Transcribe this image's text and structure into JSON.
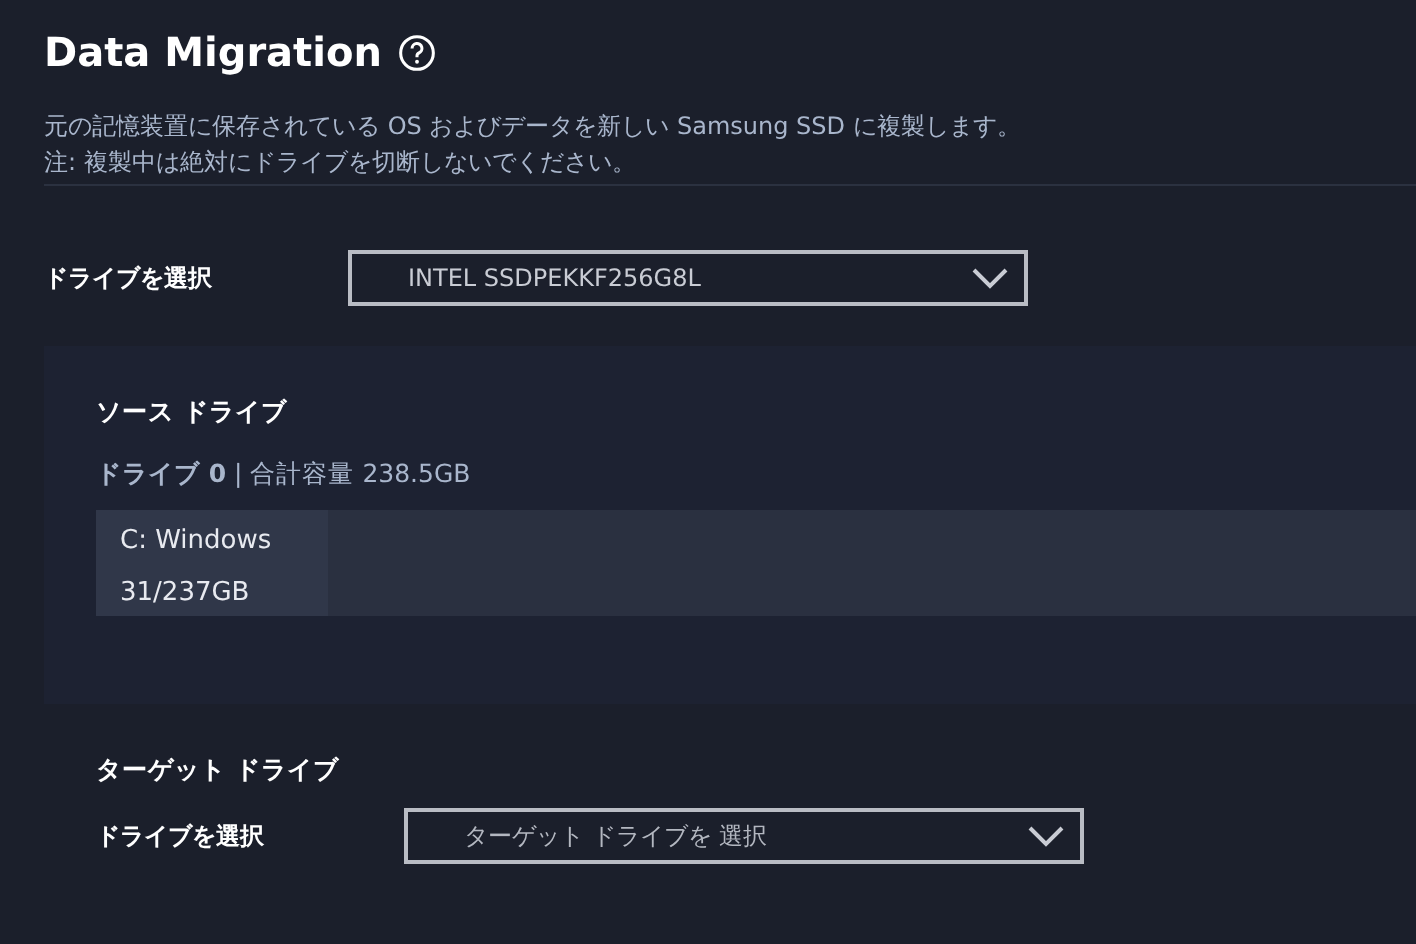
{
  "title": "Data Migration",
  "description": [
    "元の記憶装置に保存されている OS およびデータを新しい Samsung SSD に複製します。",
    "注: 複製中は絶対にドライブを切断しないでください。"
  ],
  "source_select": {
    "label": "ドライブを選択",
    "value": "INTEL SSDPEKKF256G8L"
  },
  "source_drive": {
    "heading": "ソース ドライブ",
    "info": "**ドライブ 0** | 合計容量 238.5GB",
    "partitions": [
      {
        "name": "C: Windows",
        "usage": "31/237GB"
      }
    ]
  },
  "target_drive": {
    "heading": "ターゲット ドライブ",
    "label": "ドライブを選択",
    "placeholder": "ターゲット ドライブを 選択"
  }
}
